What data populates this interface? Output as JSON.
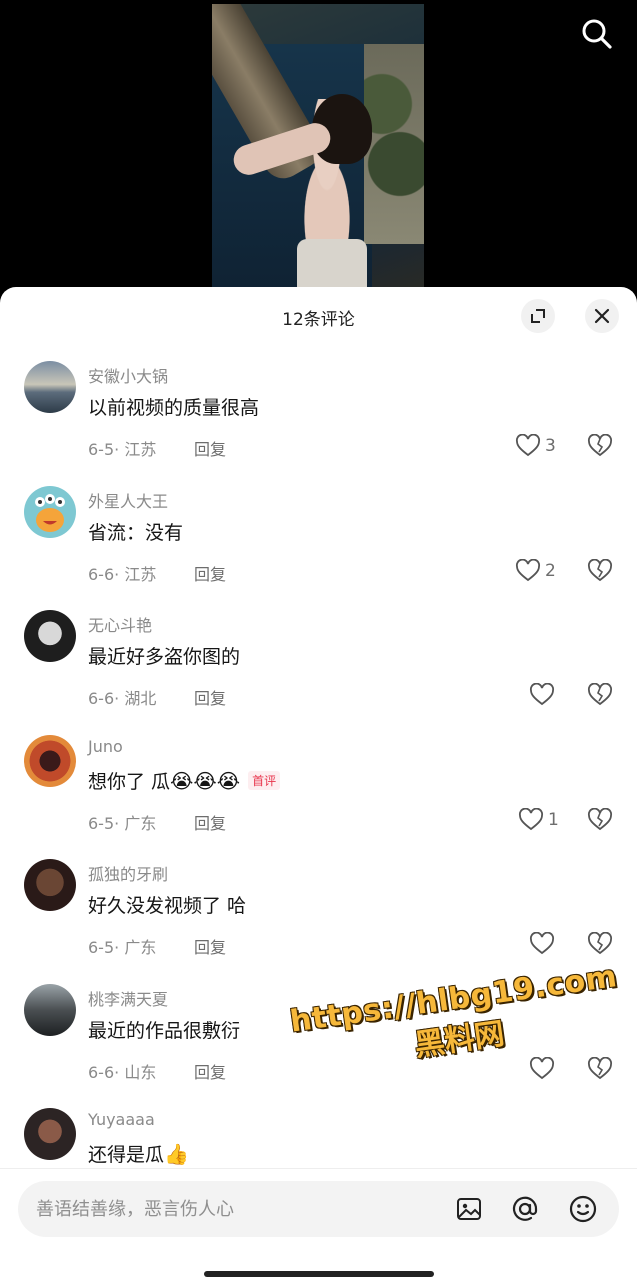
{
  "header": {
    "comment_count_title": "12条评论"
  },
  "input": {
    "placeholder": "善语结善缘，恶言伤人心"
  },
  "watermark": {
    "url": "https://hlbg19.com",
    "name": "黑料网"
  },
  "first_badge_label": "首评",
  "comments": [
    {
      "username": "安徽小大锅",
      "text": "以前视频的质量很高",
      "date": "6-5",
      "location": "江苏",
      "reply_label": "回复",
      "likes": "3"
    },
    {
      "username": "外星人大王",
      "text": "省流：没有",
      "date": "6-6",
      "location": "江苏",
      "reply_label": "回复",
      "likes": "2"
    },
    {
      "username": "无心斗艳",
      "text": "最近好多盗你图的",
      "date": "6-6",
      "location": "湖北",
      "reply_label": "回复",
      "likes": ""
    },
    {
      "username": "Juno",
      "text": "想你了 瓜",
      "emoji": "😭😭😭",
      "date": "6-5",
      "location": "广东",
      "reply_label": "回复",
      "likes": "1",
      "first": true
    },
    {
      "username": "孤独的牙刷",
      "text": "好久没发视频了 哈",
      "date": "6-5",
      "location": "广东",
      "reply_label": "回复",
      "likes": ""
    },
    {
      "username": "桃李满天夏",
      "text": "最近的作品很敷衍",
      "date": "6-6",
      "location": "山东",
      "reply_label": "回复",
      "likes": ""
    },
    {
      "username": "Yuyaaaa",
      "text": "还得是瓜",
      "emoji": "👍",
      "date": "",
      "location": "",
      "reply_label": "",
      "likes": ""
    }
  ],
  "colors": {
    "accent_badge": "#e8344b",
    "watermark": "#f6b83a",
    "muted_text": "#8a8a8a"
  },
  "icons": [
    "search-icon",
    "expand-icon",
    "close-icon",
    "heart-icon",
    "broken-heart-icon",
    "image-icon",
    "at-icon",
    "emoji-icon"
  ]
}
